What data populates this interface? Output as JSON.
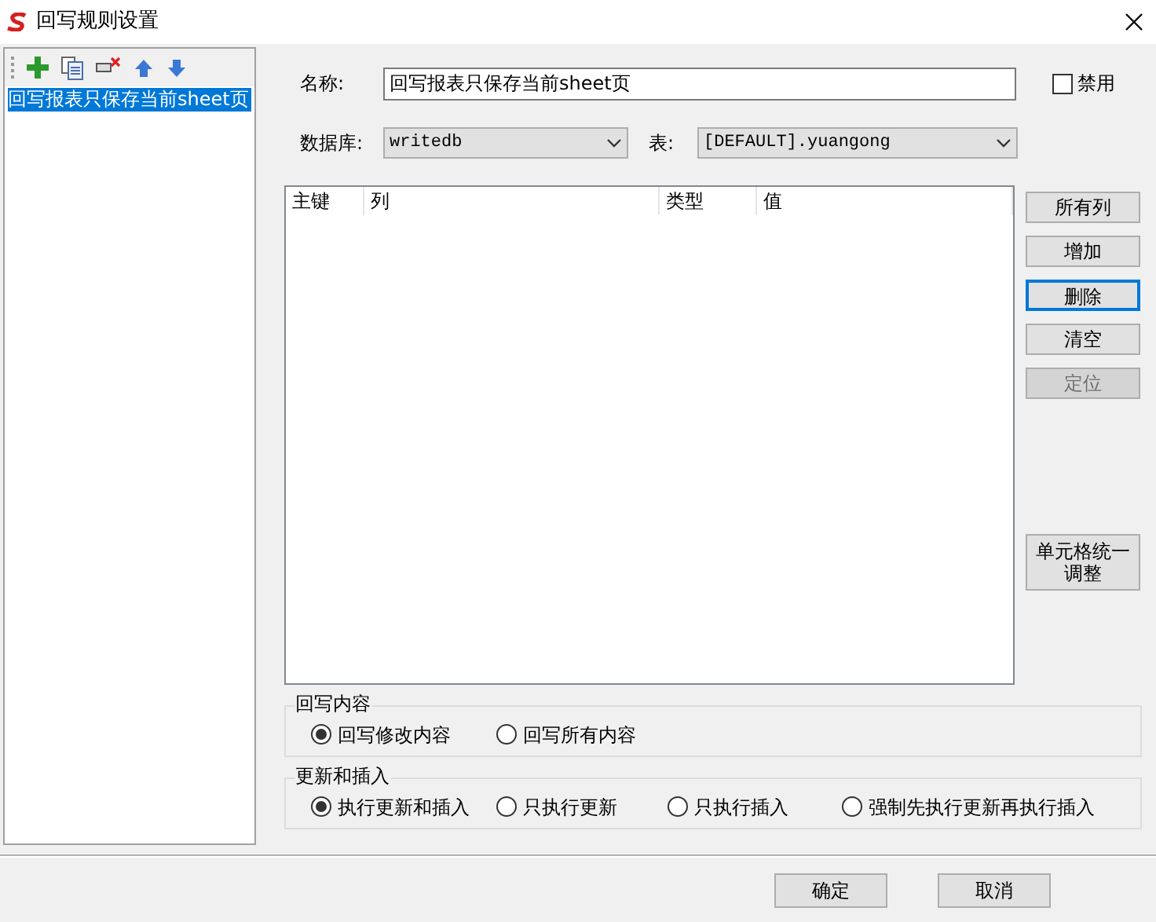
{
  "window": {
    "title": "回写规则设置"
  },
  "rules": [
    {
      "label": "回写报表只保存当前sheet页",
      "selected": true
    }
  ],
  "form": {
    "name_label": "名称:",
    "name_value": "回写报表只保存当前sheet页",
    "disable": {
      "label": "禁用",
      "checked": false
    },
    "db_label": "数据库:",
    "db_value": "writedb",
    "table_label": "表:",
    "table_value": "[DEFAULT].yuangong"
  },
  "grid": {
    "columns": [
      "主键",
      "列",
      "类型",
      "值"
    ]
  },
  "side_buttons": [
    {
      "label": "所有列",
      "disabled": false,
      "focused": false
    },
    {
      "label": "增加",
      "disabled": false,
      "focused": false
    },
    {
      "label": "删除",
      "disabled": false,
      "focused": true
    },
    {
      "label": "清空",
      "disabled": false,
      "focused": false
    },
    {
      "label": "定位",
      "disabled": true,
      "focused": false
    }
  ],
  "cell_button": "单元格统一调整",
  "groups": [
    {
      "title": "回写内容",
      "options": [
        {
          "label": "回写修改内容",
          "selected": true
        },
        {
          "label": "回写所有内容",
          "selected": false
        }
      ]
    },
    {
      "title": "更新和插入",
      "options": [
        {
          "label": "执行更新和插入",
          "selected": true
        },
        {
          "label": "只执行更新",
          "selected": false
        },
        {
          "label": "只执行插入",
          "selected": false
        },
        {
          "label": "强制先执行更新再执行插入",
          "selected": false
        }
      ]
    }
  ],
  "footer_buttons": [
    "确定",
    "取消"
  ]
}
